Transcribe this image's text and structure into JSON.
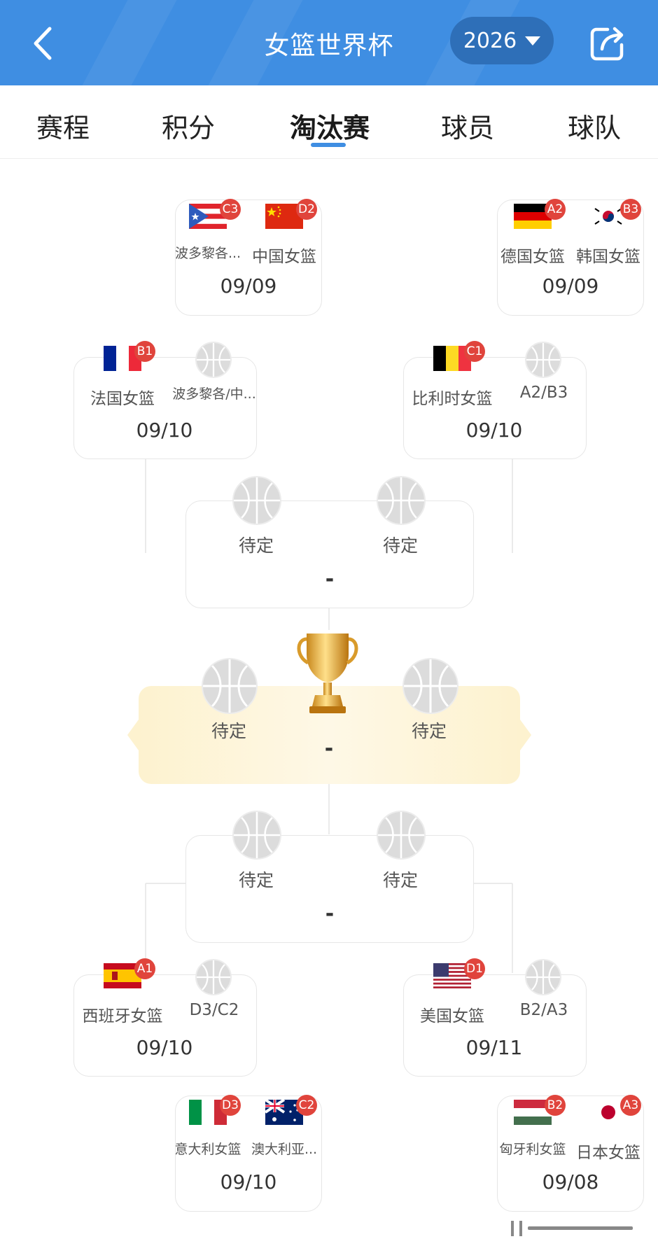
{
  "header": {
    "title": "女篮世界杯",
    "year": "2026",
    "accent": "#3f8ee2"
  },
  "tabs": [
    "赛程",
    "积分",
    "淘汰赛",
    "球员",
    "球队"
  ],
  "active_tab": "淘汰赛",
  "pending_label": "待定",
  "score_placeholder": "-",
  "matches": {
    "top_left": {
      "date": "09/09",
      "team1": {
        "name": "波多黎各...",
        "seed": "C3"
      },
      "team2": {
        "name": "中国女篮",
        "seed": "D2"
      }
    },
    "top_right": {
      "date": "09/09",
      "team1": {
        "name": "德国女篮",
        "seed": "A2"
      },
      "team2": {
        "name": "韩国女篮",
        "seed": "B3"
      }
    },
    "qf1": {
      "date": "09/10",
      "team1": {
        "name": "法国女篮",
        "seed": "B1"
      },
      "team2": {
        "name": "波多黎各/中..."
      }
    },
    "qf2": {
      "date": "09/10",
      "team1": {
        "name": "比利时女篮",
        "seed": "C1"
      },
      "team2": {
        "name": "A2/B3"
      }
    },
    "qf3": {
      "date": "09/10",
      "team1": {
        "name": "西班牙女篮",
        "seed": "A1"
      },
      "team2": {
        "name": "D3/C2"
      }
    },
    "qf4": {
      "date": "09/11",
      "team1": {
        "name": "美国女篮",
        "seed": "D1"
      },
      "team2": {
        "name": "B2/A3"
      }
    },
    "bottom_left": {
      "date": "09/10",
      "team1": {
        "name": "意大利女篮",
        "seed": "D3"
      },
      "team2": {
        "name": "澳大利亚...",
        "seed": "C2"
      }
    },
    "bottom_right": {
      "date": "09/08",
      "team1": {
        "name": "匈牙利女篮",
        "seed": "B2"
      },
      "team2": {
        "name": "日本女篮",
        "seed": "A3"
      }
    }
  }
}
